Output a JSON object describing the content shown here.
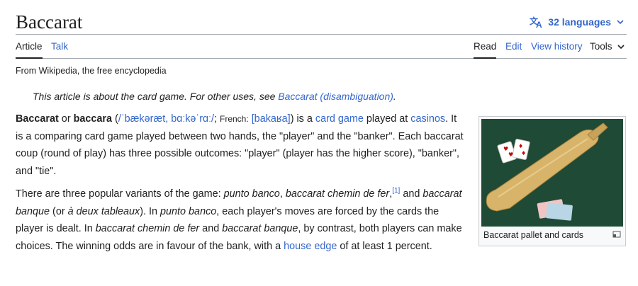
{
  "header": {
    "title": "Baccarat",
    "languages_label": "32 languages"
  },
  "tabs": {
    "article": "Article",
    "talk": "Talk",
    "read": "Read",
    "edit": "Edit",
    "view_history": "View history",
    "tools": "Tools"
  },
  "tagline": "From Wikipedia, the free encyclopedia",
  "hatnote": {
    "text": "This article is about the card game. For other uses, see ",
    "link": "Baccarat (disambiguation)",
    "end": "."
  },
  "para1": {
    "bold1": "Baccarat",
    "t1": " or ",
    "bold2": "baccara",
    "t2": " (",
    "ipa": "/ˈbækəræt, bɑːkəˈrɑː/",
    "t3": "; ",
    "french_label": "French:",
    "t4": " ",
    "french_ipa": "[bakaʁa]",
    "t5": ") is a ",
    "link1": "card game",
    "t6": " played at ",
    "link2": "casinos",
    "t7": ". It is a comparing card game played between two hands, the \"player\" and the \"banker\". Each baccarat coup (round of play) has three possible outcomes: \"player\" (player has the higher score), \"banker\", and \"tie\"."
  },
  "para2": {
    "t1": "There are three popular variants of the game: ",
    "i1": "punto banco",
    "t2": ", ",
    "i2": "baccarat chemin de fer",
    "t3": ",",
    "ref": "[1]",
    "t4": " and ",
    "i3": "baccarat banque",
    "t5": " (or ",
    "i4": "à deux tableaux",
    "t6": "). In ",
    "i5": "punto banco",
    "t7": ", each player's moves are forced by the cards the player is dealt. In ",
    "i6": "baccarat chemin de fer",
    "t8": " and ",
    "i7": "baccarat banque",
    "t9": ", by contrast, both players can make choices. The winning odds are in favour of the bank, with a ",
    "link": "house edge",
    "t10": " of at least 1 percent."
  },
  "infobox": {
    "caption": "Baccarat pallet and cards"
  },
  "colors": {
    "link": "#3366cc",
    "text": "#202122",
    "border": "#a2a9b1",
    "felt": "#1f4a35"
  },
  "icons": [
    "translate-icon",
    "chevron-down-icon",
    "enlarge-icon"
  ]
}
